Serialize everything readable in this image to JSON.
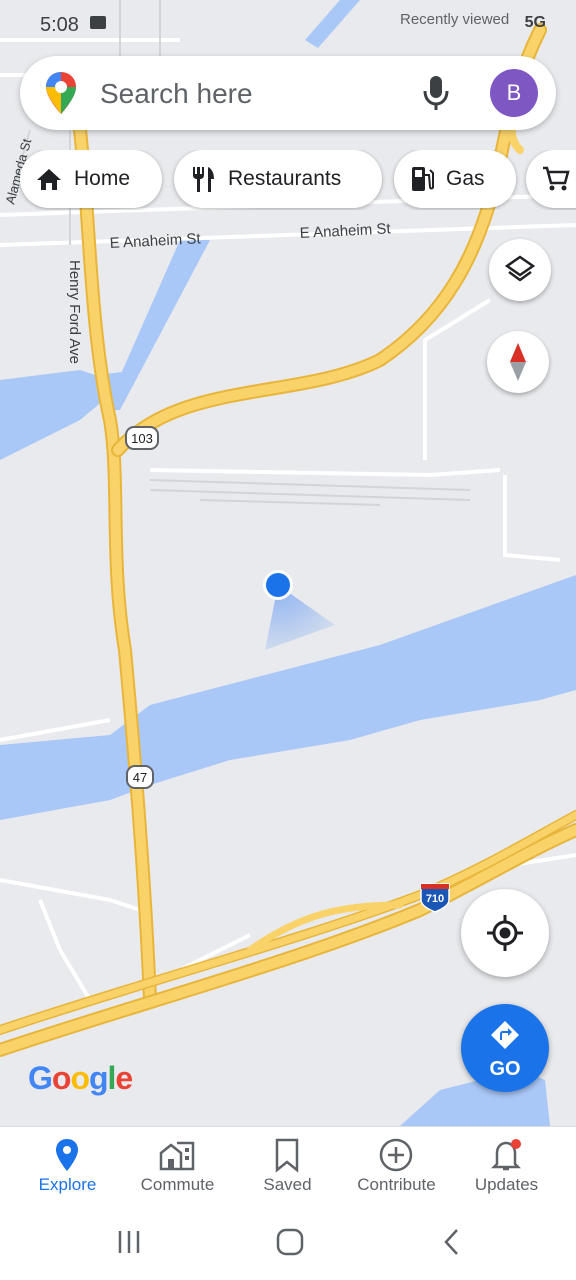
{
  "status_bar": {
    "time": "5:08",
    "network": "5G"
  },
  "overlay_text": "Recently viewed",
  "search": {
    "placeholder": "Search here",
    "avatar_letter": "B"
  },
  "chips": [
    {
      "label": "Home",
      "icon": "home-icon"
    },
    {
      "label": "Restaurants",
      "icon": "fork-knife-icon"
    },
    {
      "label": "Gas",
      "icon": "gas-pump-icon"
    },
    {
      "label": "",
      "icon": "shopping-cart-icon"
    }
  ],
  "map": {
    "street_labels": [
      "E Anaheim St",
      "E Anaheim St",
      "Alameda St",
      "Henry Ford Ave"
    ],
    "route_shields": [
      "103",
      "47",
      "710"
    ],
    "brand": "Google"
  },
  "go_button": {
    "label": "GO"
  },
  "bottom_nav": [
    {
      "label": "Explore",
      "icon": "explore-pin-icon",
      "active": true
    },
    {
      "label": "Commute",
      "icon": "commute-icon",
      "active": false
    },
    {
      "label": "Saved",
      "icon": "bookmark-icon",
      "active": false
    },
    {
      "label": "Contribute",
      "icon": "add-circle-icon",
      "active": false
    },
    {
      "label": "Updates",
      "icon": "bell-icon",
      "active": false
    }
  ],
  "colors": {
    "water": "#a9c7f7",
    "highway": "#f9d36a",
    "highway_edge": "#e8b53a",
    "accent": "#1a73e8",
    "land": "#e8eaed"
  }
}
